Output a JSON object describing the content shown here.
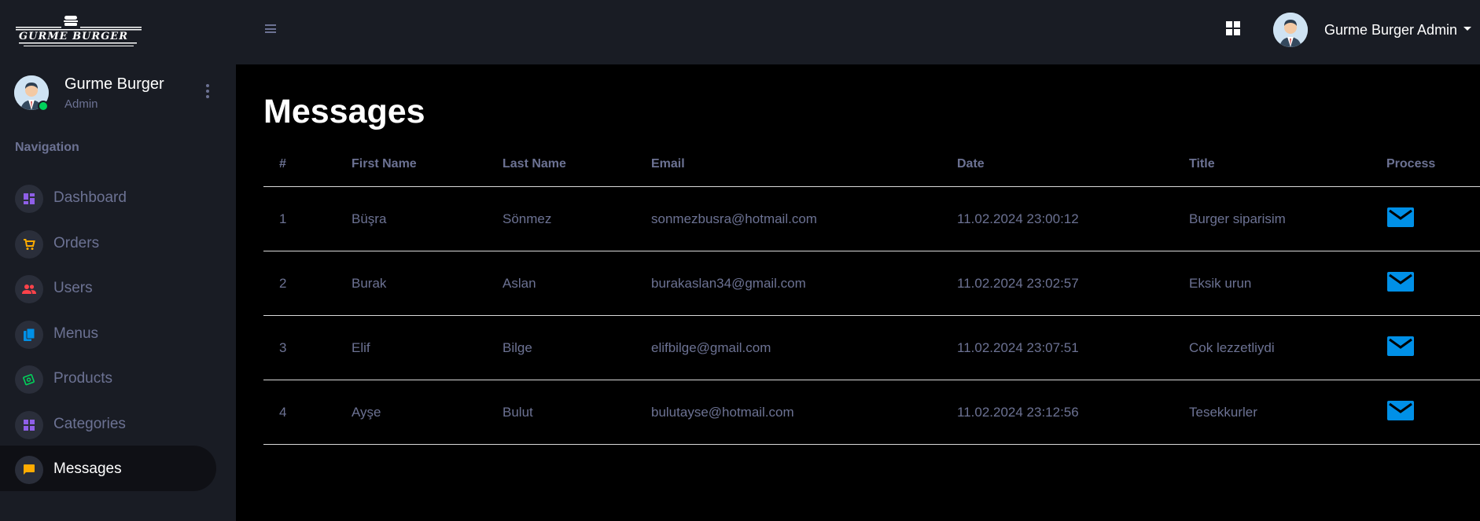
{
  "brand": {
    "logo_text": "GURME BURGER"
  },
  "profile": {
    "name": "Gurme Burger",
    "role": "Admin"
  },
  "nav": {
    "heading": "Navigation",
    "items": [
      {
        "label": "Dashboard",
        "icon": "dashboard-icon",
        "color": "#8f5fe8"
      },
      {
        "label": "Orders",
        "icon": "cart-icon",
        "color": "#ffab00"
      },
      {
        "label": "Users",
        "icon": "users-icon",
        "color": "#fc424a"
      },
      {
        "label": "Menus",
        "icon": "book-icon",
        "color": "#0090e7"
      },
      {
        "label": "Products",
        "icon": "cash-icon",
        "color": "#00d25b"
      },
      {
        "label": "Categories",
        "icon": "grid-icon",
        "color": "#8f5fe8"
      },
      {
        "label": "Messages",
        "icon": "message-icon",
        "color": "#ffab00"
      }
    ]
  },
  "topbar": {
    "user_name": "Gurme Burger Admin"
  },
  "page": {
    "title": "Messages"
  },
  "table": {
    "headers": [
      "#",
      "First Name",
      "Last Name",
      "Email",
      "Date",
      "Title",
      "Process"
    ],
    "rows": [
      {
        "id": "1",
        "first": "Büşra",
        "last": "Sönmez",
        "email": "sonmezbusra@hotmail.com",
        "date": "11.02.2024 23:00:12",
        "title": "Burger siparisim"
      },
      {
        "id": "2",
        "first": "Burak",
        "last": "Aslan",
        "email": "burakaslan34@gmail.com",
        "date": "11.02.2024 23:02:57",
        "title": "Eksik urun"
      },
      {
        "id": "3",
        "first": "Elif",
        "last": "Bilge",
        "email": "elifbilge@gmail.com",
        "date": "11.02.2024 23:07:51",
        "title": "Cok lezzetliydi"
      },
      {
        "id": "4",
        "first": "Ayşe",
        "last": "Bulut",
        "email": "bulutayse@hotmail.com",
        "date": "11.02.2024 23:12:56",
        "title": "Tesekkurler"
      }
    ]
  },
  "colors": {
    "accent": "#0090e7",
    "sidebar": "#191c24",
    "muted": "#6c7293"
  }
}
